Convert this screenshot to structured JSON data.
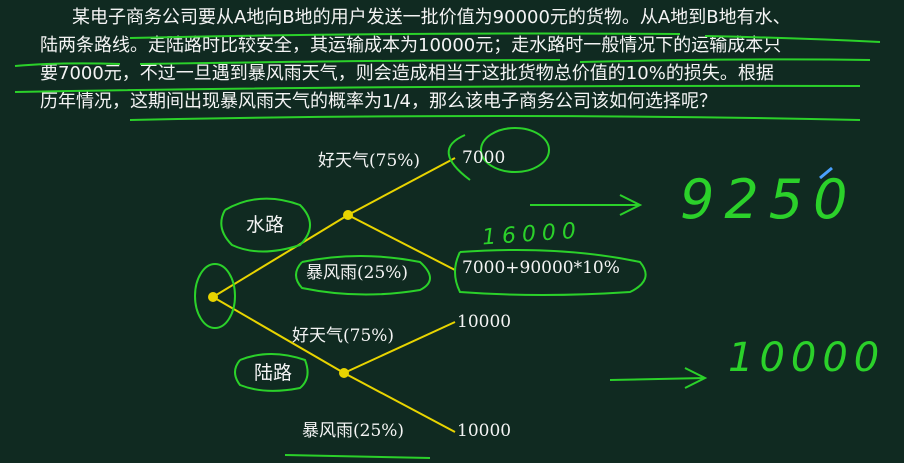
{
  "problem": {
    "lines": [
      "某电子商务公司要从A地向B地的用户发送一批价值为90000元的货物。从A地到B地有水、",
      "陆两条路线。走陆路时比较安全，其运输成本为10000元；走水路时一般情况下的运输成本只",
      "要7000元，不过一旦遇到暴风雨天气，则会造成相当于这批货物总价值的10%的损失。根据",
      "历年情况，这期间出现暴风雨天气的概率为1/4，那么该电子商务公司该如何选择呢？"
    ]
  },
  "tree": {
    "water": {
      "label": "水路",
      "good": {
        "label": "好天气(75%)",
        "value": "7000"
      },
      "storm": {
        "label": "暴风雨(25%)",
        "value": "7000+90000*10%"
      }
    },
    "land": {
      "label": "陆路",
      "good": {
        "label": "好天气(75%)",
        "value": "10000"
      },
      "storm": {
        "label": "暴风雨(25%)",
        "value": "10000"
      }
    }
  },
  "handwriting": {
    "storm_cost": "16000",
    "water_expected": "9250",
    "land_expected": "10000"
  },
  "colors": {
    "background": "#102a21",
    "tree": "#e8d400",
    "ink": "#2bd12a",
    "text": "#f4f4f4"
  }
}
